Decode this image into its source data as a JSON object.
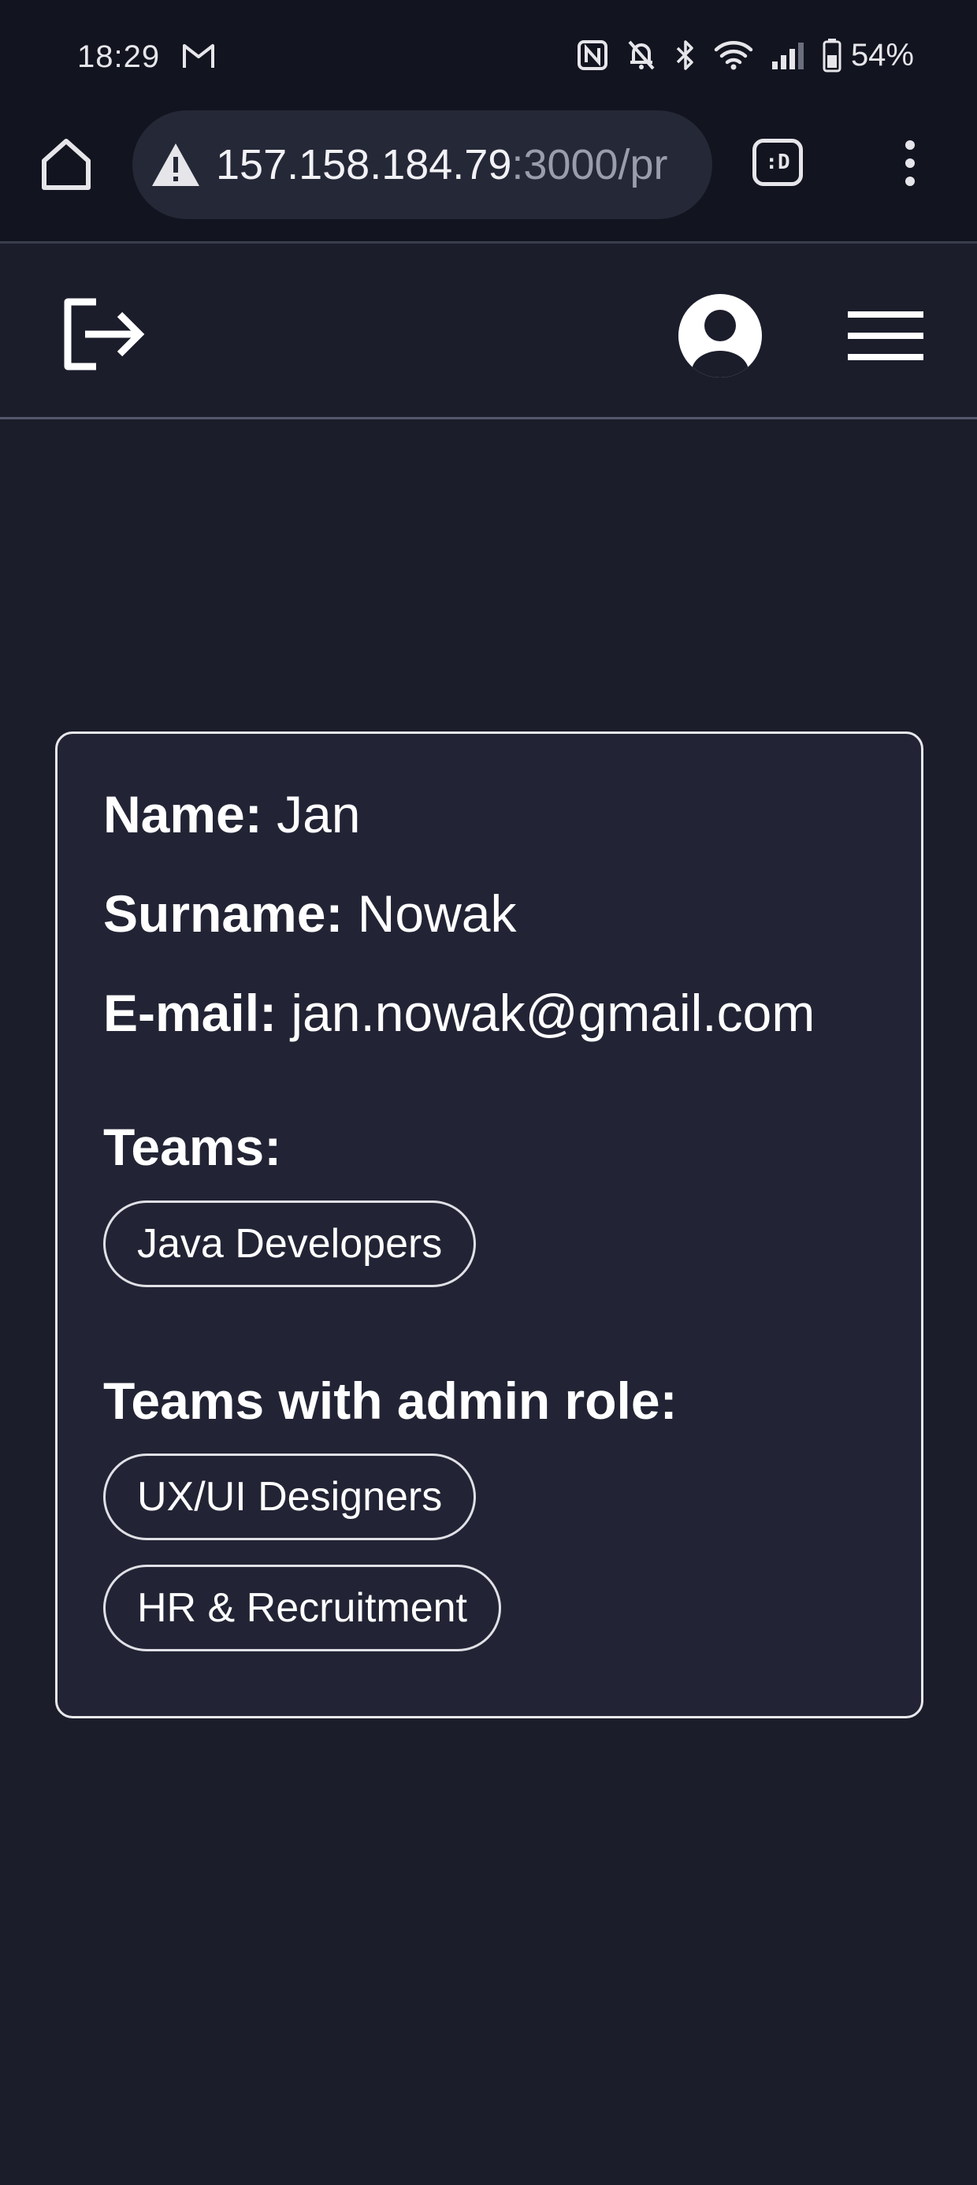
{
  "status_bar": {
    "time": "18:29",
    "battery": "54%",
    "icons": [
      "gmail-icon",
      "nfc-icon",
      "bell-off-icon",
      "bluetooth-icon",
      "wifi-icon",
      "signal-icon",
      "battery-icon"
    ]
  },
  "browser": {
    "url_host": "157.158.184.79",
    "url_rest": ":3000/pr",
    "tabs_label": ":D",
    "icons": [
      "home-icon",
      "warning-icon",
      "tabs-icon",
      "kebab-menu-icon"
    ]
  },
  "header": {
    "icons": [
      "logout-icon",
      "user-avatar-icon",
      "hamburger-menu-icon"
    ]
  },
  "profile": {
    "name_label": "Name:",
    "name_value": "Jan",
    "surname_label": "Surname:",
    "surname_value": "Nowak",
    "email_label": "E-mail:",
    "email_value": "jan.nowak@gmail.com",
    "teams_heading": "Teams:",
    "teams": [
      "Java Developers"
    ],
    "admin_heading": "Teams with admin role:",
    "admin_teams": [
      "UX/UI Designers",
      "HR & Recruitment"
    ]
  },
  "colors": {
    "background": "#1b1d2b",
    "card_background": "#222435",
    "browser_chrome": "#121420",
    "text": "#ffffff"
  }
}
